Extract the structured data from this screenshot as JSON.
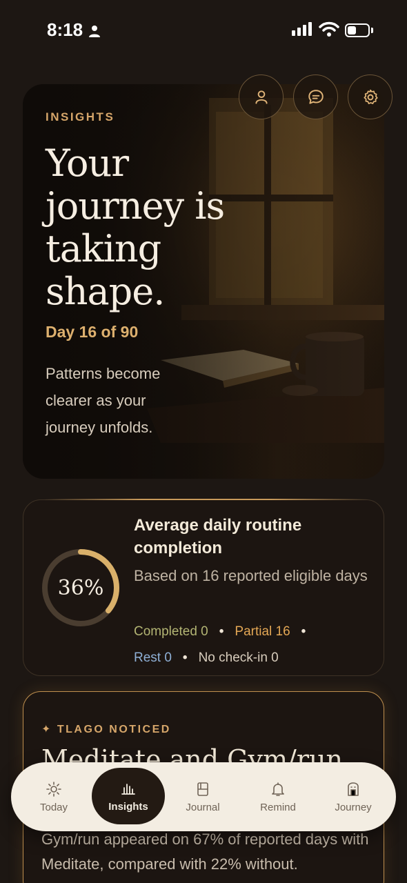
{
  "status_bar": {
    "time": "8:18"
  },
  "hero": {
    "label": "INSIGHTS",
    "title": "Your journey is taking shape.",
    "day": "Day 16 of 90",
    "description": "Patterns become clearer as your journey unfolds."
  },
  "header_icons": [
    {
      "icon": "profile-icon"
    },
    {
      "icon": "chat-icon"
    },
    {
      "icon": "settings-icon"
    }
  ],
  "stat": {
    "percent": "36%",
    "percent_value": 36,
    "title": "Average daily routine completion",
    "subtitle": "Based on 16 reported eligible days",
    "completed": "Completed 0",
    "partial": "Partial 16",
    "rest": "Rest 0",
    "no_checkin": "No check-in 0",
    "colors": {
      "completed": "#b3b574",
      "partial": "#e3a755",
      "rest": "#8fb0d6",
      "ring": "#d9b06a"
    }
  },
  "noticed": {
    "label": "✦ TLAGO NOTICED",
    "title": "Meditate and Gym/run",
    "body": "Gym/run appeared on 67% of reported days with Meditate, compared with 22% without."
  },
  "tabs": [
    {
      "label": "Today",
      "icon": "sun-icon"
    },
    {
      "label": "Insights",
      "icon": "bar-chart-icon",
      "active": true
    },
    {
      "label": "Journal",
      "icon": "journal-icon"
    },
    {
      "label": "Remind",
      "icon": "bell-icon"
    },
    {
      "label": "Journey",
      "icon": "journey-icon"
    }
  ]
}
